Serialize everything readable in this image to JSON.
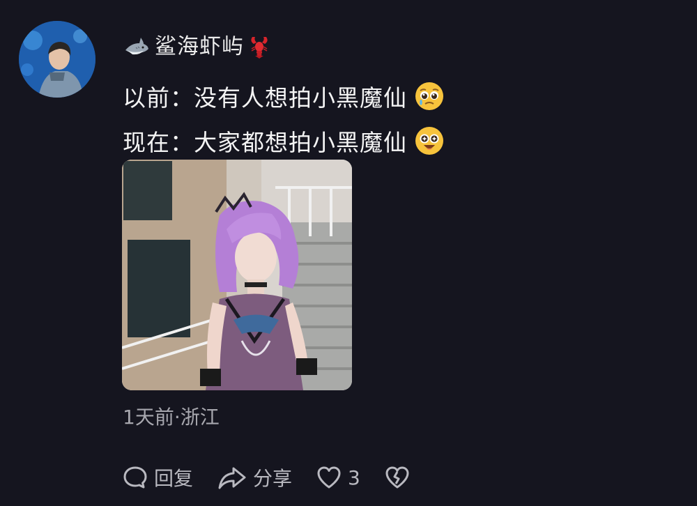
{
  "comment": {
    "username": "鲨海虾屿",
    "lines": [
      "以前：没有人想拍小黑魔仙",
      "现在：大家都想拍小黑魔仙"
    ],
    "meta": "1天前·浙江",
    "icons": {
      "avatar": "user-avatar",
      "prefix": "shark-icon",
      "suffix": "lobster-icon",
      "emoji1": "pleading-face-icon",
      "emoji2": "starry-eyes-face-icon"
    }
  },
  "actions": {
    "reply_label": "回复",
    "share_label": "分享",
    "like_count": "3"
  },
  "colors": {
    "background": "#15151f",
    "text": "#f4f4f4",
    "meta": "#a7a7ae",
    "action": "#b9b9c0"
  }
}
